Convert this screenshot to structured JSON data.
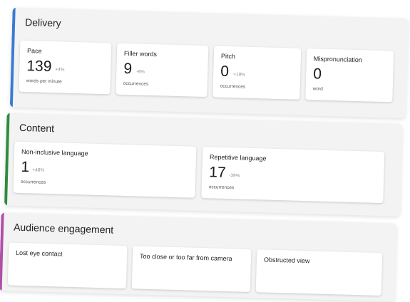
{
  "delivery": {
    "title": "Delivery",
    "accent": "#3a7bd5",
    "cards": [
      {
        "title": "Pace",
        "value": "139",
        "delta": "+4%",
        "unit": "words per minute"
      },
      {
        "title": "Filler words",
        "value": "9",
        "delta": "-6%",
        "unit": "occurrences"
      },
      {
        "title": "Pitch",
        "value": "0",
        "delta": "+18%",
        "unit": "occurrences"
      },
      {
        "title": "Mispronunciation",
        "value": "0",
        "delta": "",
        "unit": "word"
      }
    ]
  },
  "content": {
    "title": "Content",
    "accent": "#2e8b3e",
    "cards": [
      {
        "title": "Non-inclusive language",
        "value": "1",
        "delta": "+48%",
        "unit": "occurrences"
      },
      {
        "title": "Repetitive language",
        "value": "17",
        "delta": "-39%",
        "unit": "occurrences"
      }
    ]
  },
  "engagement": {
    "title": "Audience engagement",
    "accent": "#b04fa8",
    "cards": [
      {
        "title": "Lost eye contact"
      },
      {
        "title": "Too close or too far from camera"
      },
      {
        "title": "Obstructed view"
      }
    ]
  }
}
